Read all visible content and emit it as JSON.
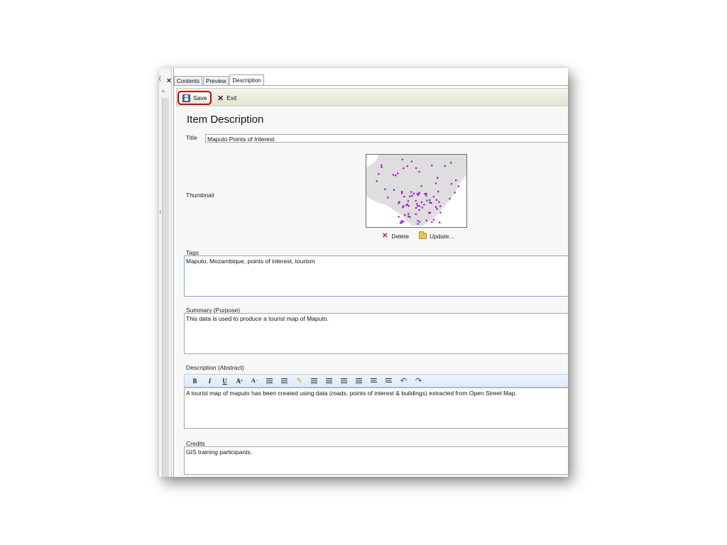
{
  "tabs": [
    {
      "label": "Contents"
    },
    {
      "label": "Preview"
    },
    {
      "label": "Description",
      "active": true
    }
  ],
  "side_panel": {
    "top_stub": "(",
    "mid_stub": "t",
    "close_glyph": "×",
    "scroll_up_glyph": "^"
  },
  "toolbar": {
    "save_label": "Save",
    "exit_label": "Exit"
  },
  "page_title": "Item Description",
  "form": {
    "title_label": "Title",
    "title_value": "Maputo Points of Interest",
    "thumbnail_label": "Thumbnail",
    "delete_label": "Delete",
    "update_label": "Update...",
    "tags_label": "Tags",
    "tags_value": "Maputo, Mozambique, points of interest, tourism",
    "summary_label": "Summary (Purpose)",
    "summary_value": "This data is used to produce a tourist map of Maputo.",
    "description_label": "Description (Abstract)",
    "description_value": "A tourist map of maputo has been created using data (roads, points of interest & buildings) extracted from Open Street Map.",
    "credits_label": "Credits",
    "credits_value": "GIS training participants."
  },
  "rte_toolbar": {
    "bold": "B",
    "italic": "I",
    "underline": "U",
    "grow_font": "A",
    "shrink_font": "A",
    "undo": "↶",
    "redo": "↷"
  },
  "colors": {
    "save_highlight": "#d40000",
    "toolbar_bg": "#e3e4d4",
    "rte_toolbar_bg": "#dfe9f5",
    "field_border_focus": "#7fa7d4",
    "map_land": "#dedede",
    "poi_primary": "#b000d8",
    "poi_secondary": "#4040c0"
  }
}
